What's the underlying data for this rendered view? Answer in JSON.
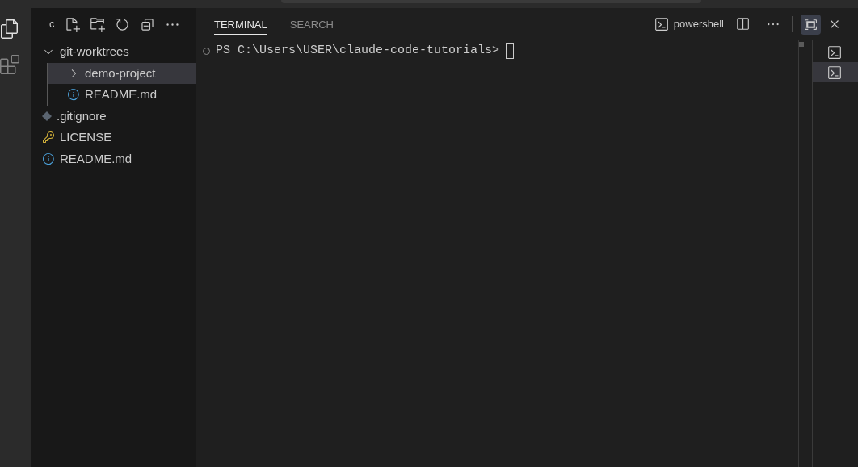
{
  "sidebar": {
    "title": "c",
    "tree": [
      {
        "name": "git-worktrees",
        "kind": "folder",
        "expanded": true,
        "selected": false,
        "children": [
          {
            "name": "demo-project",
            "kind": "folder",
            "expanded": false,
            "selected": true
          },
          {
            "name": "README.md",
            "kind": "info",
            "selected": false
          }
        ]
      },
      {
        "name": ".gitignore",
        "kind": "git",
        "selected": false
      },
      {
        "name": "LICENSE",
        "kind": "license",
        "selected": false
      },
      {
        "name": "README.md",
        "kind": "info",
        "selected": false
      }
    ]
  },
  "panel": {
    "tabs": [
      {
        "label": "TERMINAL",
        "selected": true
      },
      {
        "label": "SEARCH",
        "selected": false
      }
    ],
    "shell": "powershell",
    "prompt": "PS C:\\Users\\USER\\claude-code-tutorials>",
    "terminals": [
      {
        "selected": false
      },
      {
        "selected": true
      }
    ]
  }
}
